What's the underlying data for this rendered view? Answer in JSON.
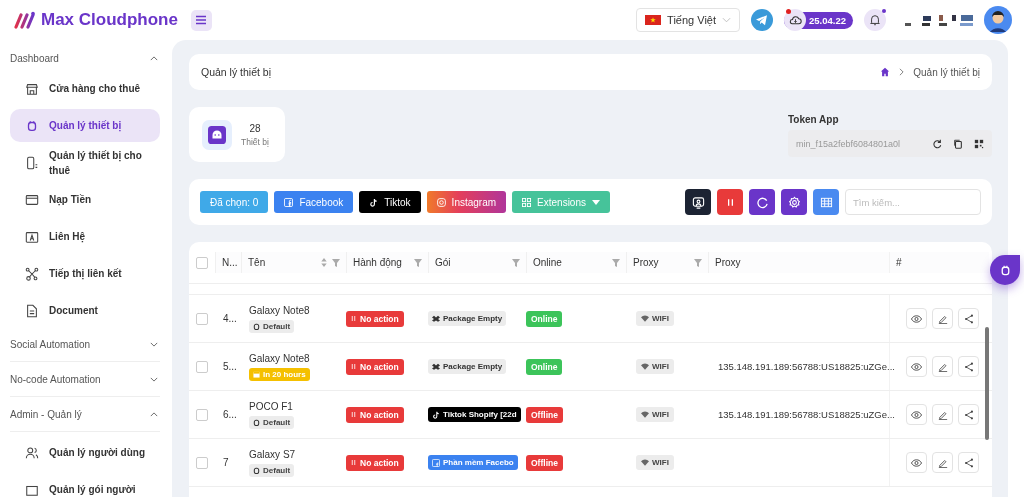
{
  "header": {
    "brand": "Max Cloudphone",
    "language": "Tiếng Việt",
    "date_badge": "25.04.22",
    "cloud_alert": true,
    "bell_alert": true
  },
  "sidebar": {
    "sections": [
      {
        "title": "Dashboard",
        "expanded": true,
        "items": [
          {
            "label": "Cửa hàng cho thuê",
            "selected": false
          },
          {
            "label": "Quản lý thiết bị",
            "selected": true
          },
          {
            "label": "Quản lý thiết bị cho thuê",
            "selected": false
          },
          {
            "label": "Nạp Tiền",
            "selected": false
          },
          {
            "label": "Liên Hệ",
            "selected": false
          },
          {
            "label": "Tiếp thị liên kết",
            "selected": false
          },
          {
            "label": "Document",
            "selected": false
          }
        ]
      },
      {
        "title": "Social Automation",
        "expanded": false
      },
      {
        "title": "No-code Automation",
        "expanded": false
      },
      {
        "title": "Admin - Quản lý",
        "expanded": true,
        "items": [
          {
            "label": "Quản lý người dùng",
            "selected": false
          },
          {
            "label": "Quản lý gói người",
            "selected": false
          }
        ]
      }
    ]
  },
  "page_title": "Quản lý thiết bị",
  "breadcrumb": [
    "Quản lý thiết bị"
  ],
  "stats": {
    "value": "28",
    "label": "Thiết bị"
  },
  "token": {
    "label": "Token App",
    "value": "min_f15a2febf6084801a0l"
  },
  "toolbar": {
    "buttons": [
      {
        "label": "Đã chọn: 0",
        "kind": "count"
      },
      {
        "label": "Facebook",
        "kind": "facebook"
      },
      {
        "label": "Tiktok",
        "kind": "tiktok"
      },
      {
        "label": "Instagram",
        "kind": "instagram"
      },
      {
        "label": "Extensions",
        "kind": "extensions"
      }
    ],
    "icon_buttons": [
      {
        "kind": "screen"
      },
      {
        "kind": "pause"
      },
      {
        "kind": "refresh"
      },
      {
        "kind": "settings"
      },
      {
        "kind": "grid"
      }
    ],
    "search_placeholder": "Tìm kiếm..."
  },
  "table": {
    "select_all": false,
    "columns": [
      {
        "label": "N...",
        "sort": false,
        "filter": false
      },
      {
        "label": "Tên",
        "sort": true,
        "filter": true
      },
      {
        "label": "Hành động",
        "sort": false,
        "filter": true
      },
      {
        "label": "Gói",
        "sort": false,
        "filter": true
      },
      {
        "label": "Online",
        "sort": false,
        "filter": true
      },
      {
        "label": "Proxy",
        "sort": false,
        "filter": true
      },
      {
        "label": "Proxy",
        "sort": false,
        "filter": false
      },
      {
        "label": "#",
        "sort": false,
        "filter": false
      }
    ],
    "rows": [
      {
        "checked": false,
        "no": "4...",
        "name": "Galaxy Note8",
        "tag": {
          "label": "Default",
          "kind": "default"
        },
        "action": "No action",
        "package": {
          "label": "Package Empty",
          "kind": "empty"
        },
        "online": {
          "label": "Online",
          "connected": true
        },
        "proxy_type": "WIFI"
      },
      {
        "checked": false,
        "no": "5...",
        "name": "Galaxy Note8",
        "tag": {
          "label": "In 20 hours",
          "kind": "expiry"
        },
        "action": "No action",
        "package": {
          "label": "Package Empty",
          "kind": "empty"
        },
        "online": {
          "label": "Online",
          "connected": true
        },
        "proxy_type": "WIFI",
        "proxy": "135.148.191.189:56788:US18825:uZGe..."
      },
      {
        "checked": false,
        "no": "6...",
        "name": "POCO F1",
        "tag": {
          "label": "Default",
          "kind": "default"
        },
        "action": "No action",
        "package": {
          "label": "Tiktok Shopify [22d",
          "kind": "tiktok"
        },
        "online": {
          "label": "Offline",
          "connected": false
        },
        "proxy_type": "WIFI",
        "proxy": "135.148.191.189:56788:US18825:uZGe..."
      },
      {
        "checked": false,
        "no": "7",
        "name": "Galaxy S7",
        "tag": {
          "label": "Default",
          "kind": "default"
        },
        "action": "No action",
        "package": {
          "label": "Phần mềm Facebo",
          "kind": "facebook"
        },
        "online": {
          "label": "Offline",
          "connected": false
        },
        "proxy_type": "WIFI"
      }
    ]
  }
}
